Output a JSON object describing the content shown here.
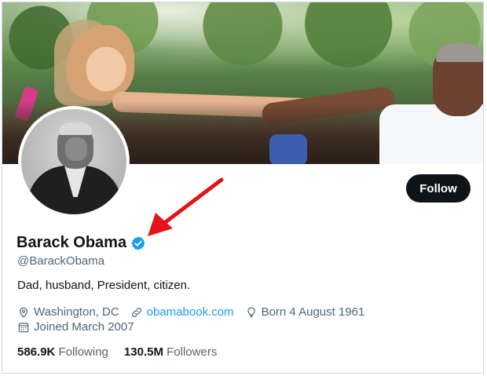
{
  "profile": {
    "name": "Barack Obama",
    "handle": "@BarackObama",
    "bio": "Dad, husband, President, citizen.",
    "location": "Washington, DC",
    "website": "obamabook.com",
    "born": "Born 4 August 1961",
    "joined": "Joined March 2007",
    "verified": true
  },
  "actions": {
    "follow_label": "Follow"
  },
  "stats": {
    "following_count": "586.9K",
    "following_label": "Following",
    "followers_count": "130.5M",
    "followers_label": "Followers"
  },
  "icons": {
    "location": "location-pin-icon",
    "website": "link-icon",
    "born": "balloon-icon",
    "joined": "calendar-icon",
    "verified": "verified-badge-icon"
  },
  "colors": {
    "verified_blue": "#1d9bf0",
    "link_blue": "#1d9bf0",
    "follow_button": "#0f1419",
    "muted_text": "#536471",
    "annotation_arrow": "#e3131b"
  }
}
